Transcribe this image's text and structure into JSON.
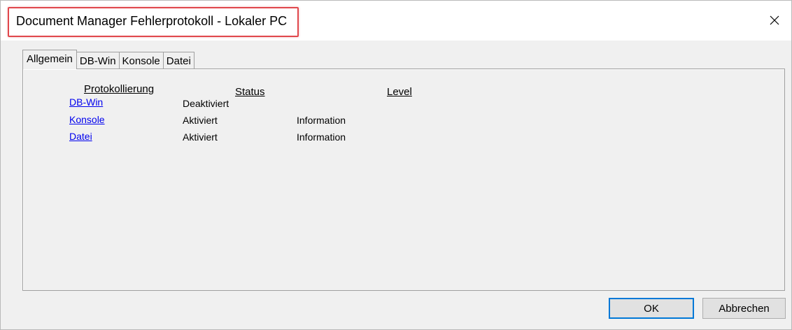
{
  "window": {
    "title": "Document Manager Fehlerprotokoll - Lokaler PC"
  },
  "tabs": [
    {
      "label": "Allgemein",
      "active": true
    },
    {
      "label": "DB-Win",
      "active": false
    },
    {
      "label": "Konsole",
      "active": false
    },
    {
      "label": "Datei",
      "active": false
    }
  ],
  "table": {
    "headers": {
      "protokollierung": "Protokollierung",
      "status": "Status",
      "level": "Level"
    },
    "rows": [
      {
        "name": "DB-Win",
        "status": "Deaktiviert",
        "level": ""
      },
      {
        "name": "Konsole",
        "status": "Aktiviert",
        "level": "Information"
      },
      {
        "name": "Datei",
        "status": "Aktiviert",
        "level": "Information"
      }
    ]
  },
  "buttons": {
    "ok": "OK",
    "cancel": "Abbrechen"
  },
  "colors": {
    "highlight": "#e0474c",
    "link": "#0000ee"
  },
  "icons": {
    "close": "close-icon"
  }
}
